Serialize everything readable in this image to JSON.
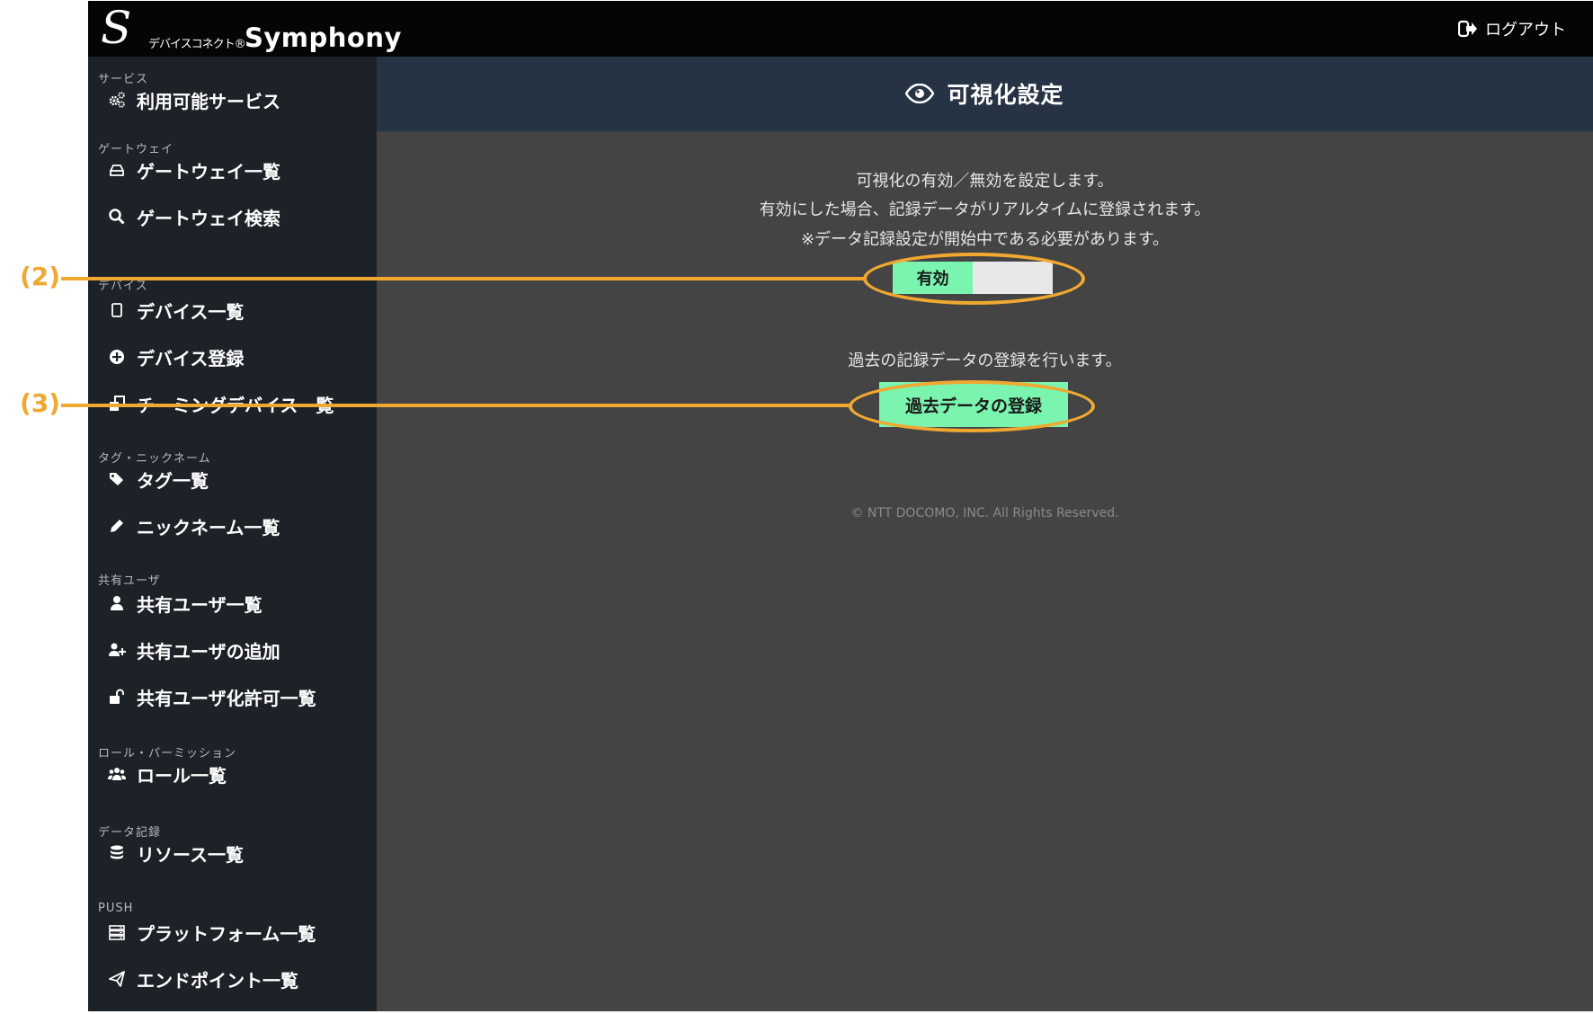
{
  "header": {
    "logo_mark": "S",
    "logo_subtitle": "デバイスコネクト®",
    "logo_brand": "Symphony",
    "logout_label": "ログアウト"
  },
  "sidebar": {
    "sections": [
      {
        "title": "サービス",
        "items": [
          {
            "label": "利用可能サービス",
            "icon": "gears-icon"
          }
        ]
      },
      {
        "title": "ゲートウェイ",
        "items": [
          {
            "label": "ゲートウェイ一覧",
            "icon": "hdd-icon"
          },
          {
            "label": "ゲートウェイ検索",
            "icon": "search-icon"
          }
        ]
      },
      {
        "title": "デバイス",
        "items": [
          {
            "label": "デバイス一覧",
            "icon": "tablet-icon"
          },
          {
            "label": "デバイス登録",
            "icon": "plus-circle-icon"
          },
          {
            "label": "チーミングデバイス一覧",
            "icon": "clone-icon"
          }
        ]
      },
      {
        "title": "タグ・ニックネーム",
        "items": [
          {
            "label": "タグ一覧",
            "icon": "tags-icon"
          },
          {
            "label": "ニックネーム一覧",
            "icon": "pencil-icon"
          }
        ]
      },
      {
        "title": "共有ユーザ",
        "items": [
          {
            "label": "共有ユーザ一覧",
            "icon": "user-icon"
          },
          {
            "label": "共有ユーザの追加",
            "icon": "user-plus-icon"
          },
          {
            "label": "共有ユーザ化許可一覧",
            "icon": "unlock-icon"
          }
        ]
      },
      {
        "title": "ロール・パーミッション",
        "items": [
          {
            "label": "ロール一覧",
            "icon": "users-icon"
          }
        ]
      },
      {
        "title": "データ記録",
        "items": [
          {
            "label": "リソース一覧",
            "icon": "database-icon"
          }
        ]
      },
      {
        "title": "PUSH",
        "items": [
          {
            "label": "プラットフォーム一覧",
            "icon": "server-icon"
          },
          {
            "label": "エンドポイント一覧",
            "icon": "paper-plane-icon"
          }
        ]
      }
    ]
  },
  "main": {
    "title": "可視化設定",
    "title_icon": "eye-icon",
    "description_lines": [
      "可視化の有効／無効を設定します。",
      "有効にした場合、記録データがリアルタイムに登録されます。",
      "※データ記録設定が開始中である必要があります。"
    ],
    "toggle_label": "有効",
    "toggle_state": "on",
    "register_description": "過去の記録データの登録を行います。",
    "register_button_label": "過去データの登録",
    "footer": "© NTT DOCOMO, INC. All Rights Reserved."
  },
  "annotations": [
    {
      "label": "(2)"
    },
    {
      "label": "(3)"
    }
  ],
  "colors": {
    "accent_green": "#7af4ae",
    "annotation_orange": "#f0a830",
    "sidebar_bg": "#1d2229",
    "header_bg": "#263345",
    "content_bg": "#444444"
  }
}
